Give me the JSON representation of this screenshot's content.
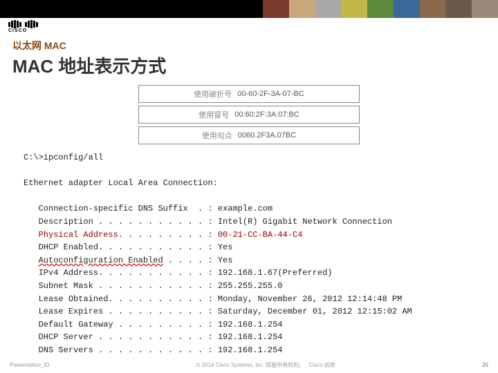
{
  "logo_text": "CISCO",
  "subtitle": "以太网 MAC",
  "title": "MAC 地址表示方式",
  "formats": [
    {
      "label": "使用破折号",
      "value": "00-60-2F-3A-07-BC"
    },
    {
      "label": "使用冒号",
      "value": "00:60:2F:3A:07:BC"
    },
    {
      "label": "使用句点",
      "value": "0060.2F3A.07BC"
    }
  ],
  "cmd_prompt": "C:\\>ipconfig/all",
  "adapter_header": "Ethernet adapter Local Area Connection:",
  "ip": {
    "suffix": {
      "k": "Connection-specific DNS Suffix",
      "v": "example.com"
    },
    "desc": {
      "k": "Description",
      "v": "Intel(R) Gigabit Network Connection"
    },
    "phys": {
      "k": "Physical Address",
      "v": "00-21-CC-BA-44-C4"
    },
    "dhcp_en": {
      "k": "DHCP Enabled",
      "v": "Yes"
    },
    "autocfg": {
      "k": "Autoconfiguration Enabled",
      "v": "Yes"
    },
    "ipv4": {
      "k": "IPv4 Address",
      "v": "192.168.1.67(Preferred)"
    },
    "mask": {
      "k": "Subnet Mask",
      "v": "255.255.255.0"
    },
    "lease_o": {
      "k": "Lease Obtained",
      "v": "Monday, November 26, 2012 12:14:48 PM"
    },
    "lease_e": {
      "k": "Lease Expires",
      "v": "Saturday, December 01, 2012 12:15:02 AM"
    },
    "gateway": {
      "k": "Default Gateway",
      "v": "192.168.1.254"
    },
    "dhcp_srv": {
      "k": "DHCP Server",
      "v": "192.168.1.254"
    },
    "dns": {
      "k": "DNS Servers",
      "v": "192.168.1.254"
    }
  },
  "footer": {
    "left": "Presentation_ID",
    "center": "© 2014 Cisco Systems, Inc. 保留所有权利。",
    "clabel": "Cisco 机密",
    "page": "25"
  }
}
